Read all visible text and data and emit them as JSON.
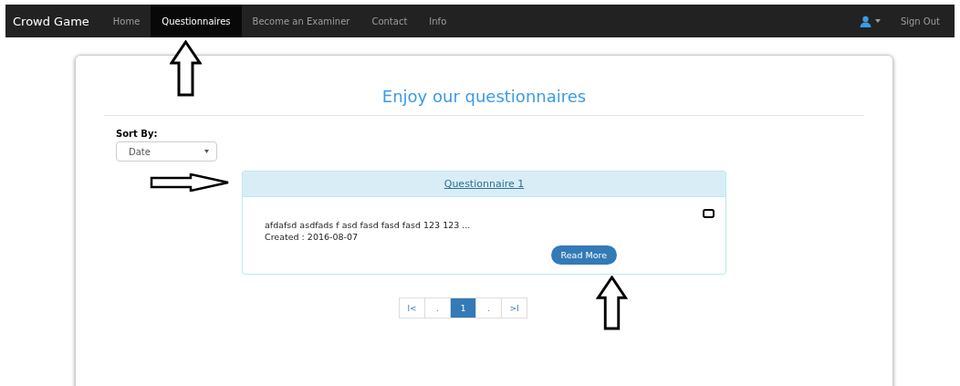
{
  "navbar": {
    "brand": "Crowd Game",
    "links": [
      {
        "label": "Home",
        "selected": false
      },
      {
        "label": "Questionnaires",
        "selected": true
      },
      {
        "label": "Become an Examiner",
        "selected": false
      },
      {
        "label": "Contact",
        "selected": false
      },
      {
        "label": "Info",
        "selected": false
      }
    ],
    "sign_out": "Sign Out"
  },
  "heading": "Enjoy our questionnaires",
  "sort": {
    "label": "Sort By:",
    "value": "Date"
  },
  "questionnaires": [
    {
      "title": "Questionnaire 1",
      "summary": "afdafsd asdfads f asd fasd fasd fasd 123 123 ...",
      "created": "Created : 2016-08-07",
      "checked": false,
      "button": "Read More"
    }
  ],
  "pagination": [
    {
      "label": "I<",
      "selected": false
    },
    {
      "label": ".",
      "selected": false
    },
    {
      "label": "1",
      "selected": true
    },
    {
      "label": ".",
      "selected": false
    },
    {
      "label": ">I",
      "selected": false
    }
  ],
  "annotations": [
    {
      "kind": "up"
    },
    {
      "kind": "right"
    },
    {
      "kind": "up"
    }
  ]
}
